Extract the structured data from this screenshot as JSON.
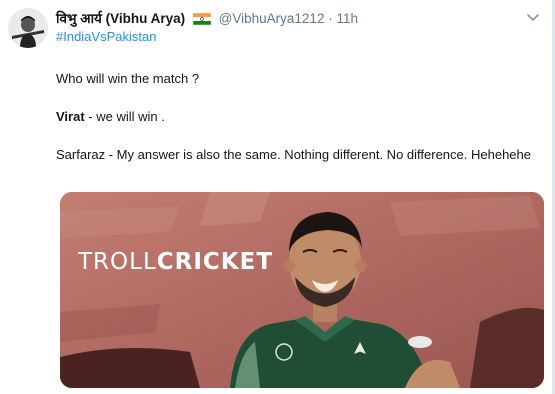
{
  "author": {
    "display_name": "विभु आर्य (Vibhu Arya)",
    "flag_icon": "india-flag-icon",
    "handle": "@VibhuArya1212",
    "separator": "·",
    "time": "11h"
  },
  "hashtag": "#IndiaVsPakistan",
  "body": {
    "line1": "Who will win the match ?",
    "line2_speaker": "Virat",
    "line2_rest": " - we will win .",
    "line3": "Sarfaraz - My answer is also the same. Nothing different. No difference. Hehehehe"
  },
  "media": {
    "watermark_part1": "TROLL",
    "watermark_part2": "CRICKET"
  },
  "colors": {
    "link": "#1b95e0",
    "secondary_text": "#657786",
    "wall": "#b06a62",
    "jersey": "#1f4d35"
  }
}
